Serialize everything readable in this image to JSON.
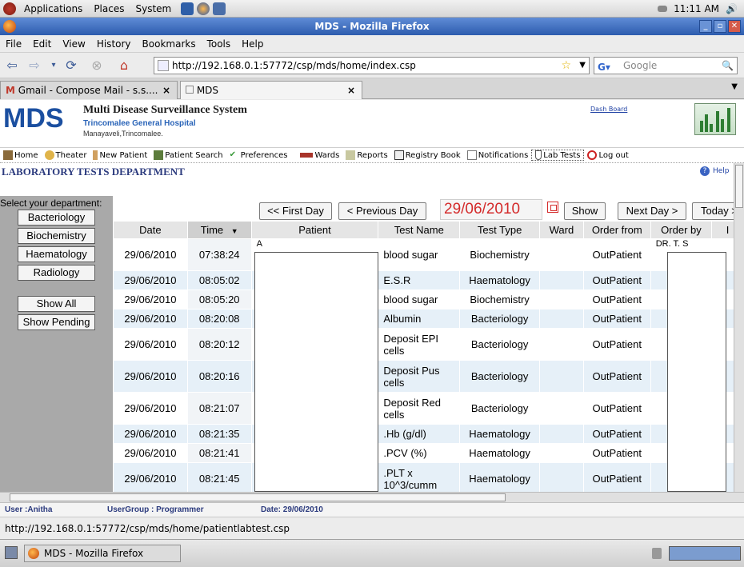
{
  "gnome_panel": {
    "menus": [
      "Applications",
      "Places",
      "System"
    ],
    "clock": "11:11 AM"
  },
  "window": {
    "title": "MDS - Mozilla Firefox"
  },
  "menubar": [
    "File",
    "Edit",
    "View",
    "History",
    "Bookmarks",
    "Tools",
    "Help"
  ],
  "toolbar": {
    "url": "http://192.168.0.1:57772/csp/mds/home/index.csp",
    "search_placeholder": "Google"
  },
  "tabs": [
    {
      "label": "Gmail - Compose Mail - s.s....",
      "active": false
    },
    {
      "label": "MDS",
      "active": true
    }
  ],
  "header": {
    "logo": "MDS",
    "system_title": "Multi Disease Surveillance System",
    "hospital": "Trincomalee General Hospital",
    "address": "Manayaveli,Trincomalee.",
    "dashboard_link": "Dash Board"
  },
  "site_nav": [
    {
      "label": "Home",
      "icon": "home-icon"
    },
    {
      "label": "Theater",
      "icon": "theater-icon"
    },
    {
      "label": "New Patient",
      "icon": "new-patient-icon"
    },
    {
      "label": "Patient Search",
      "icon": "patient-search-icon"
    },
    {
      "label": "Preferences",
      "icon": "preferences-icon"
    },
    {
      "label": "Wards",
      "icon": "wards-icon"
    },
    {
      "label": "Reports",
      "icon": "reports-icon"
    },
    {
      "label": "Registry Book",
      "icon": "registry-book-icon"
    },
    {
      "label": "Notifications",
      "icon": "notifications-icon"
    },
    {
      "label": "Lab Tests",
      "icon": "lab-tests-icon",
      "selected": true
    },
    {
      "label": "Log out",
      "icon": "logout-icon"
    }
  ],
  "page": {
    "title": "LABORATORY TESTS DEPARTMENT",
    "help": "Help"
  },
  "left_panel": {
    "label": "Select your department:",
    "departments": [
      "Bacteriology",
      "Biochemistry",
      "Haematology",
      "Radiology"
    ],
    "show_all": "Show All",
    "show_pending": "Show Pending"
  },
  "controls": {
    "first_day": "<< First Day",
    "previous_day": "< Previous Day",
    "date": "29/06/2010",
    "show": "Show",
    "next_day": "Next Day >",
    "today": "Today >"
  },
  "table": {
    "columns": [
      "Date",
      "Time",
      "Patient",
      "Test Name",
      "Test Type",
      "Ward",
      "Order from",
      "Order by",
      "I"
    ],
    "rows": [
      {
        "date": "29/06/2010",
        "time": "07:38:24",
        "patient": "A",
        "test_name": "blood sugar",
        "test_type": "Biochemistry",
        "ward": "",
        "order_from": "OutPatient",
        "order_by": "DR. T. S"
      },
      {
        "date": "29/06/2010",
        "time": "08:05:02",
        "patient": "",
        "test_name": "E.S.R",
        "test_type": "Haematology",
        "ward": "",
        "order_from": "OutPatient",
        "order_by": ""
      },
      {
        "date": "29/06/2010",
        "time": "08:05:20",
        "patient": "",
        "test_name": "blood sugar",
        "test_type": "Biochemistry",
        "ward": "",
        "order_from": "OutPatient",
        "order_by": ""
      },
      {
        "date": "29/06/2010",
        "time": "08:20:08",
        "patient": "",
        "test_name": "Albumin",
        "test_type": "Bacteriology",
        "ward": "",
        "order_from": "OutPatient",
        "order_by": ""
      },
      {
        "date": "29/06/2010",
        "time": "08:20:12",
        "patient": "",
        "test_name": "Deposit EPI cells",
        "test_type": "Bacteriology",
        "ward": "",
        "order_from": "OutPatient",
        "order_by": ""
      },
      {
        "date": "29/06/2010",
        "time": "08:20:16",
        "patient": "",
        "test_name": "Deposit Pus cells",
        "test_type": "Bacteriology",
        "ward": "",
        "order_from": "OutPatient",
        "order_by": ""
      },
      {
        "date": "29/06/2010",
        "time": "08:21:07",
        "patient": "",
        "test_name": "Deposit Red cells",
        "test_type": "Bacteriology",
        "ward": "",
        "order_from": "OutPatient",
        "order_by": ""
      },
      {
        "date": "29/06/2010",
        "time": "08:21:35",
        "patient": "",
        "test_name": ".Hb (g/dl)",
        "test_type": "Haematology",
        "ward": "",
        "order_from": "OutPatient",
        "order_by": ""
      },
      {
        "date": "29/06/2010",
        "time": "08:21:41",
        "patient": "",
        "test_name": ".PCV (%)",
        "test_type": "Haematology",
        "ward": "",
        "order_from": "OutPatient",
        "order_by": ""
      },
      {
        "date": "29/06/2010",
        "time": "08:21:45",
        "patient": "",
        "test_name": ".PLT x 10^3/cumm",
        "test_type": "Haematology",
        "ward": "",
        "order_from": "OutPatient",
        "order_by": ""
      }
    ]
  },
  "footer": {
    "user": "User :Anitha",
    "user_group": "UserGroup : Programmer",
    "date": "Date: 29/06/2010"
  },
  "status_url": "http://192.168.0.1:57772/csp/mds/home/patientlabtest.csp",
  "taskbar": {
    "window_button": "MDS - Mozilla Firefox"
  },
  "colors": {
    "accent_title": "#2c3b7e",
    "date_red": "#d42b2b",
    "row_alt": "#e6f0f8",
    "logo_blue": "#1b4fa0"
  }
}
